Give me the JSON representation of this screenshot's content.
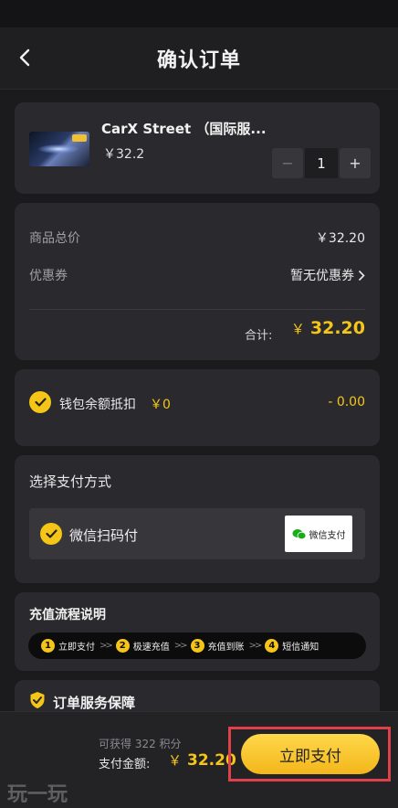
{
  "header": {
    "title": "确认订单"
  },
  "product": {
    "name": "CarX Street （国际服...",
    "price": "￥32.2",
    "quantity": "1",
    "minus": "−",
    "plus": "+"
  },
  "summary": {
    "total_label": "商品总价",
    "total_value": "￥32.20",
    "coupon_label": "优惠券",
    "coupon_value": "暂无优惠券",
    "sum_label": "合计:",
    "sum_currency": "￥",
    "sum_value": "32.20"
  },
  "wallet": {
    "label": "钱包余额抵扣",
    "balance": "￥0",
    "deduction": "- 0.00"
  },
  "payment": {
    "title": "选择支付方式",
    "method": "微信扫码付",
    "logo_text": "微信支付"
  },
  "flow": {
    "title": "充值流程说明",
    "steps": [
      {
        "num": "1",
        "label": "立即支付"
      },
      {
        "num": "2",
        "label": "极速充值"
      },
      {
        "num": "3",
        "label": "充值到账"
      },
      {
        "num": "4",
        "label": "短信通知"
      }
    ],
    "separator": ">>"
  },
  "guarantee": {
    "label": "订单服务保障"
  },
  "footer": {
    "points": "可获得 322 积分",
    "pay_label": "支付金额:",
    "pay_currency": "￥",
    "pay_value": "32.20",
    "pay_button": "立即支付"
  },
  "watermark": "玩一玩",
  "colors": {
    "accent": "#f5c518",
    "background": "#1b1b1d",
    "card": "#2a2a2e",
    "highlight_border": "#e0404a"
  }
}
